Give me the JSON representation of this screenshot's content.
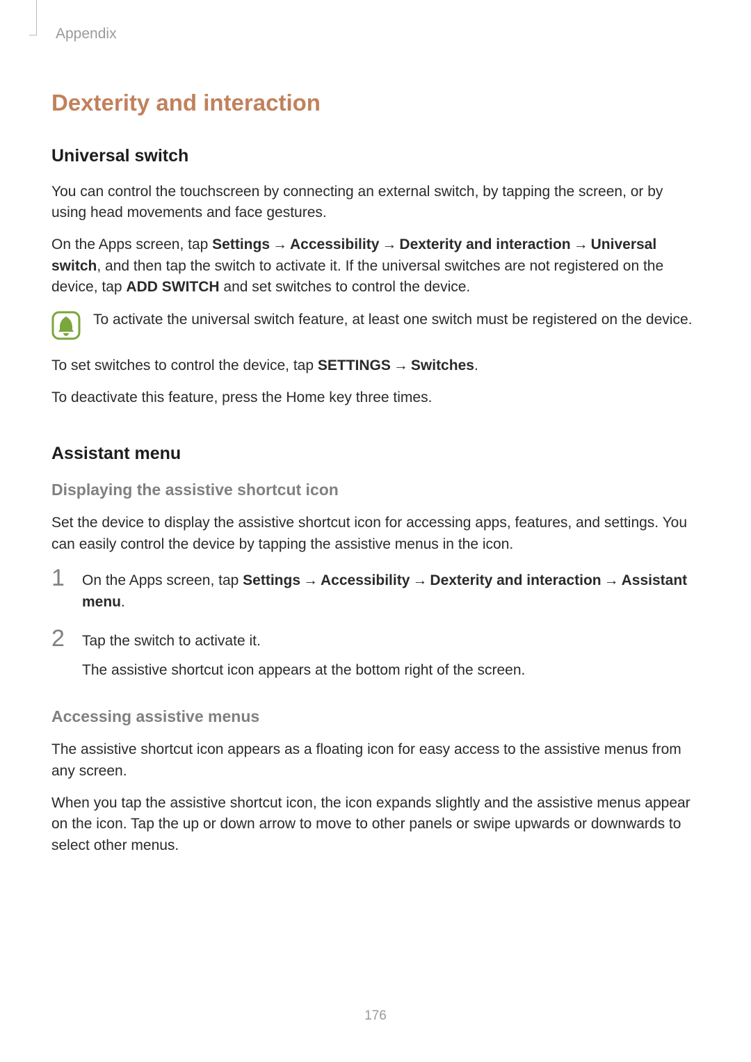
{
  "runningHeader": "Appendix",
  "sectionTitle": "Dexterity and interaction",
  "universal": {
    "title": "Universal switch",
    "p1": "You can control the touchscreen by connecting an external switch, by tapping the screen, or by using head movements and face gestures.",
    "p2_a": "On the Apps screen, tap ",
    "p2_settings": "Settings",
    "p2_arrow": " → ",
    "p2_accessibility": "Accessibility",
    "p2_di": "Dexterity and interaction",
    "p2_us": "Universal switch",
    "p2_mid": ", and then tap the switch to activate it. If the universal switches are not registered on the device, tap ",
    "p2_add": "ADD SWITCH",
    "p2_end": " and set switches to control the device.",
    "note": "To activate the universal switch feature, at least one switch must be registered on the device.",
    "p3_a": "To set switches to control the device, tap ",
    "p3_settings2": "SETTINGS",
    "p3_switches": "Switches",
    "p3_period": ".",
    "p4": "To deactivate this feature, press the Home key three times."
  },
  "assistant": {
    "title": "Assistant menu",
    "display": {
      "title": "Displaying the assistive shortcut icon",
      "p1": "Set the device to display the assistive shortcut icon for accessing apps, features, and settings. You can easily control the device by tapping the assistive menus in the icon.",
      "step1_a": "On the Apps screen, tap ",
      "step1_settings": "Settings",
      "step1_arrow": " → ",
      "step1_accessibility": "Accessibility",
      "step1_di": "Dexterity and interaction",
      "step1_am": "Assistant menu",
      "step1_period": ".",
      "step2_a": "Tap the switch to activate it.",
      "step2_b": "The assistive shortcut icon appears at the bottom right of the screen."
    },
    "access": {
      "title": "Accessing assistive menus",
      "p1": "The assistive shortcut icon appears as a floating icon for easy access to the assistive menus from any screen.",
      "p2": "When you tap the assistive shortcut icon, the icon expands slightly and the assistive menus appear on the icon. Tap the up or down arrow to move to other panels or swipe upwards or downwards to select other menus."
    }
  },
  "nums": {
    "one": "1",
    "two": "2"
  },
  "pageNumber": "176"
}
